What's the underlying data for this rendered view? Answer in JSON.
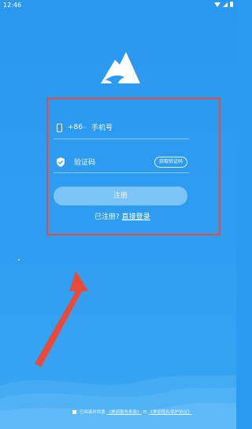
{
  "status_bar": {
    "time": "12:46"
  },
  "form": {
    "country_code": "+86",
    "phone_placeholder": "手机号",
    "code_placeholder": "验证码",
    "get_code_label": "获取验证码",
    "register_label": "注册",
    "login_prompt": "已注册?",
    "login_link": "直接登录"
  },
  "agreement": {
    "prefix": "已阅读并同意",
    "terms_link": "《美丽服务条款》",
    "conjunction": "与",
    "privacy_link": "《美丽隐私保护协议》"
  },
  "colors": {
    "background": "#2a9bf0",
    "highlight_border": "#e84b3c",
    "button_bg": "#7cc4f7"
  }
}
